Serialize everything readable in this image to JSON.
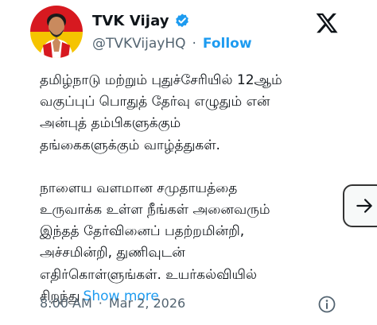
{
  "author": {
    "display_name": "TVK Vijay",
    "handle": "@TVKVijayHQ",
    "follow_label": "Follow",
    "verified": true,
    "avatar_colors": {
      "top": "#d71920",
      "bottom": "#f5c400"
    }
  },
  "tweet": {
    "paragraph1": [
      "தமிழ்நாடு மற்றும் புதுச்சேரியில் 12ஆம்",
      "வகுப்புப் பொதுத் தேர்வு எழுதும் என்",
      "அன்புத் தம்பிகளுக்கும்",
      "தங்கைகளுக்கும் வாழ்த்துகள்."
    ],
    "paragraph2": [
      "நாளைய வளமான சமுதாயத்தை",
      "உருவாக்க உள்ள நீங்கள் அனைவரும்",
      "இந்தத் தேர்வினைப் பதற்றமின்றி,",
      "அச்சமின்றி, துணிவுடன்",
      "எதிர்கொள்ளுங்கள். உயர்கல்வியில்"
    ],
    "last_line": "சிறந்து",
    "show_more_label": "Show more"
  },
  "meta": {
    "time": "8:00 AM",
    "separator": "·",
    "date": "Mar 2, 2026"
  },
  "icons": {
    "verified": "verified-badge-icon",
    "logo": "x-logo-icon",
    "next": "arrow-right-icon",
    "info": "info-icon"
  },
  "colors": {
    "accent": "#1d9bf0",
    "text": "#0f1419",
    "secondary": "#536471"
  }
}
